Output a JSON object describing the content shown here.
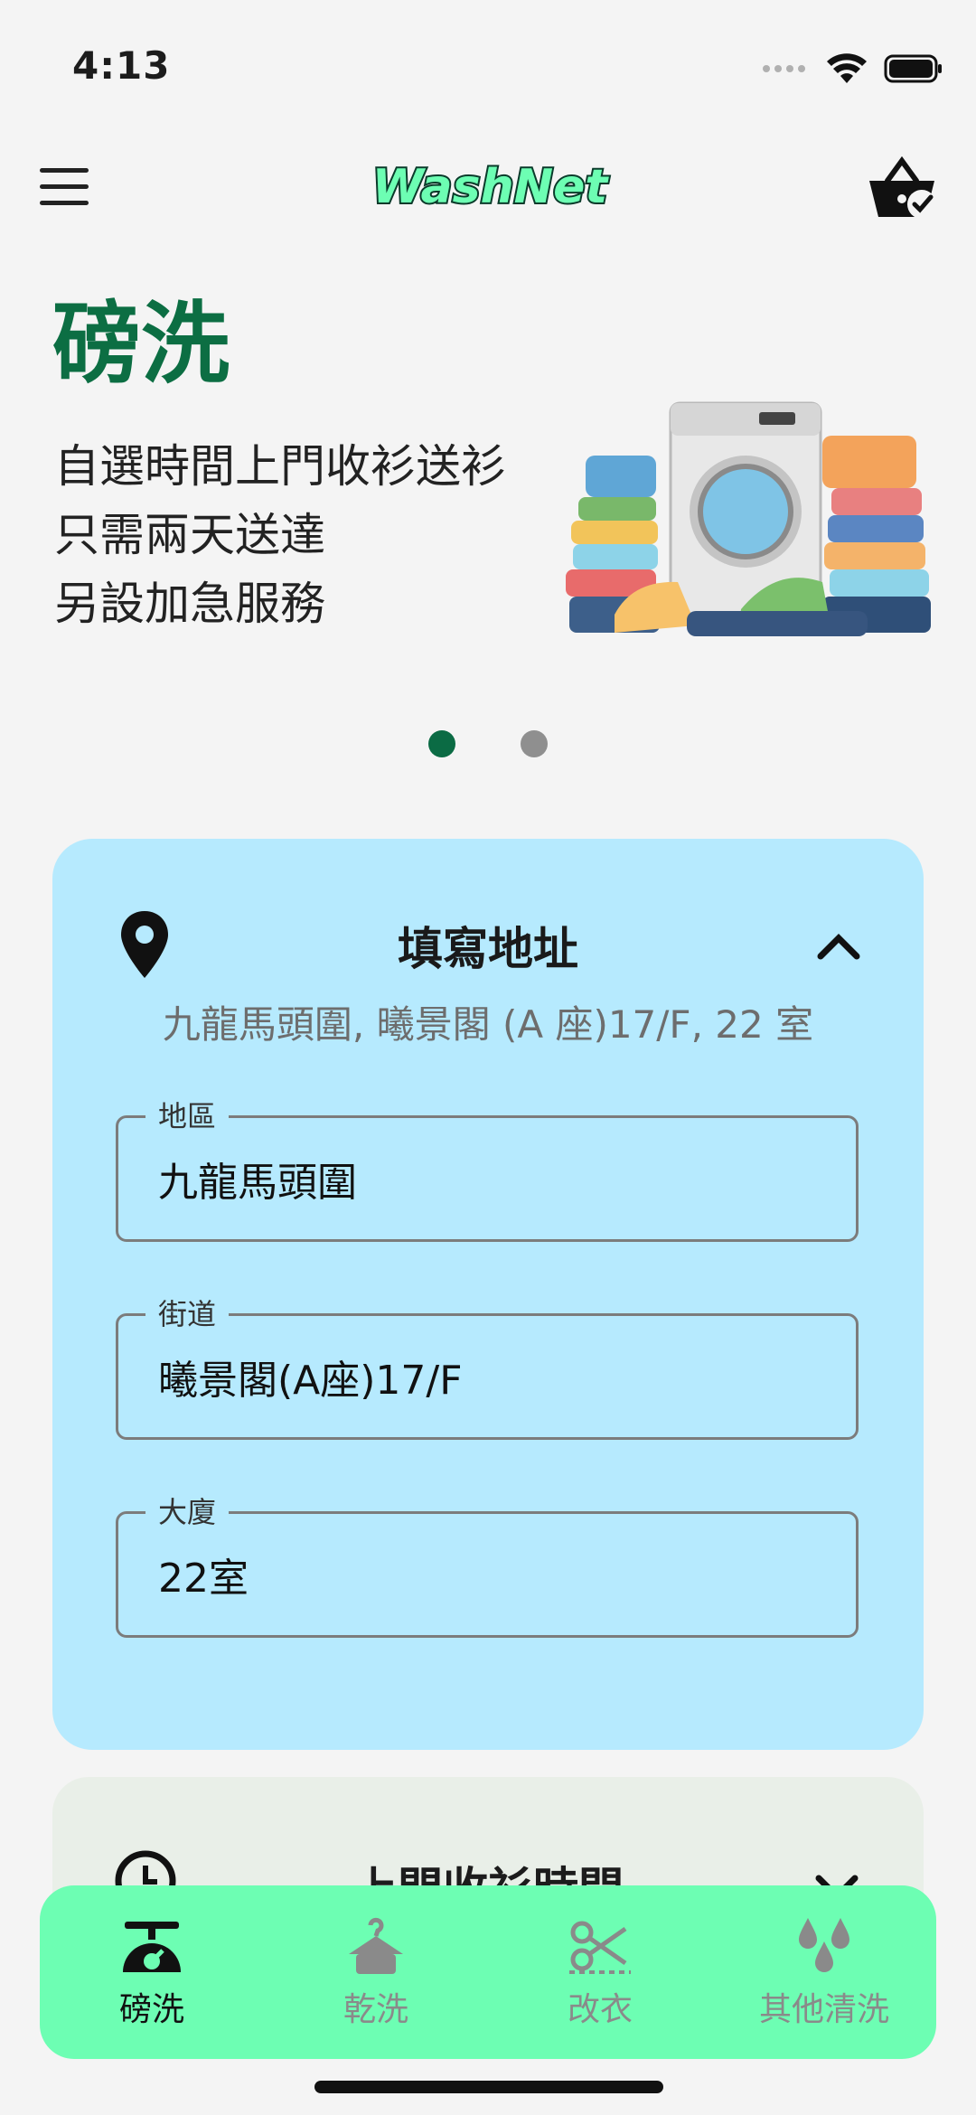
{
  "status_bar": {
    "time": "4:13"
  },
  "header": {
    "logo_text": "WashNet"
  },
  "hero": {
    "title": "磅洗",
    "lines": [
      "自選時間上門收衫送衫",
      "只需兩天送達",
      "另設加急服務"
    ],
    "slides": 2,
    "active_slide": 1
  },
  "address": {
    "title": "填寫地址",
    "summary": "九龍馬頭圍, 曦景閣 (A 座)17/F, 22 室",
    "fields": [
      {
        "label": "地區",
        "value": "九龍馬頭圍"
      },
      {
        "label": "街道",
        "value": "曦景閣(A座)17/F"
      },
      {
        "label": "大廈",
        "value": "22室"
      }
    ]
  },
  "pickup": {
    "title": "上門收衫時間"
  },
  "bottom_nav": [
    {
      "label": "磅洗",
      "icon": "scale-icon",
      "active": true
    },
    {
      "label": "乾洗",
      "icon": "hanger-icon",
      "active": false
    },
    {
      "label": "改衣",
      "icon": "scissors-icon",
      "active": false
    },
    {
      "label": "其他清洗",
      "icon": "drops-icon",
      "active": false
    }
  ],
  "colors": {
    "brand_green": "#0c6e43",
    "nav_bg": "#6dfeb3",
    "address_card_bg": "#b6eafe",
    "time_card_bg": "#e9efe8"
  }
}
